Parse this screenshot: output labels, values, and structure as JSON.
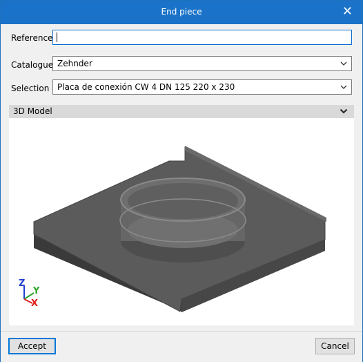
{
  "window": {
    "title": "End piece",
    "close_glyph": "✕"
  },
  "form": {
    "reference_label": "Reference",
    "reference_value": "",
    "catalogue_label": "Catalogue",
    "catalogue_value": "Zehnder",
    "selection_label": "Selection",
    "selection_value": "Placa de conexión CW 4 DN 125 220 x 230"
  },
  "model_panel": {
    "title": "3D Model",
    "chevron": "chevron-down-icon"
  },
  "axes": {
    "z": "Z",
    "y": "Y",
    "x": "X"
  },
  "buttons": {
    "accept": "Accept",
    "cancel": "Cancel"
  },
  "colors": {
    "titlebar": "#1b73c9",
    "accent": "#0078d7",
    "axis_x": "#e02020",
    "axis_y": "#2aa52a",
    "axis_z": "#2040d0"
  }
}
